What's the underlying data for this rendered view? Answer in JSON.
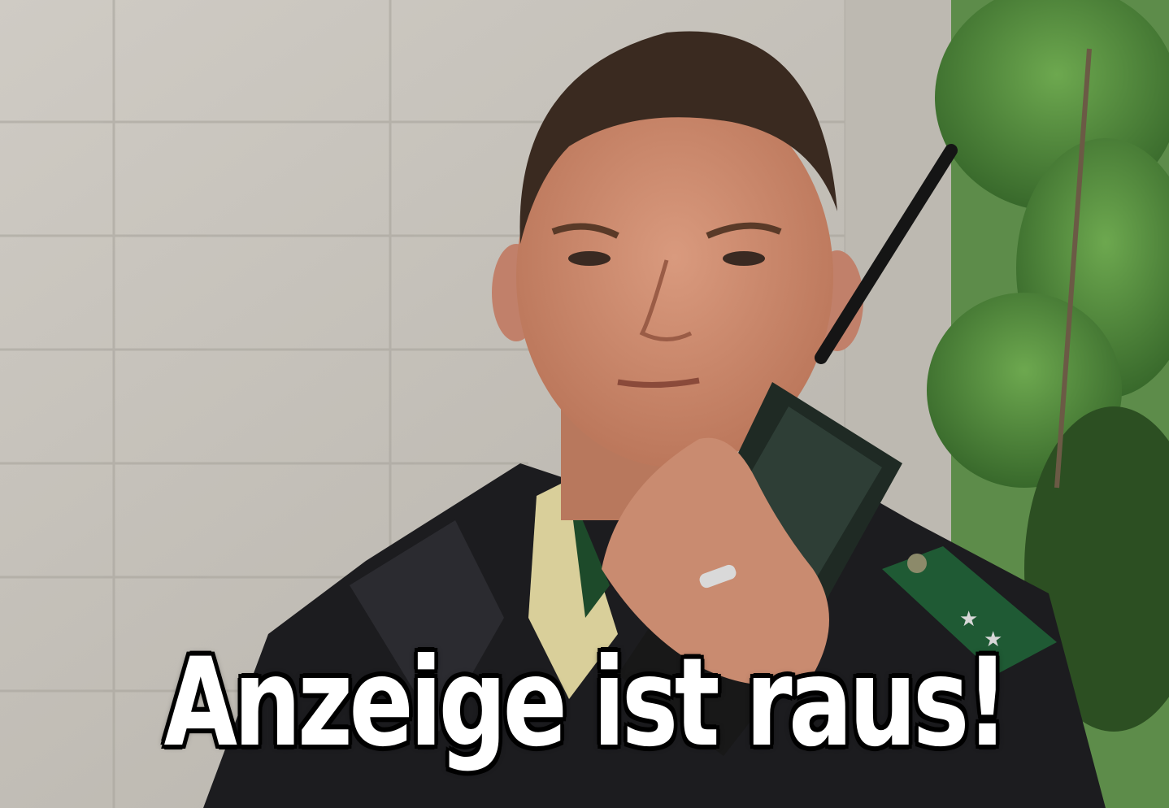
{
  "meme": {
    "caption": "Anzeige ist raus!"
  },
  "photo": {
    "subject": "police-officer-with-radio-icon"
  },
  "colors": {
    "wall": "#c3bfb8",
    "foliage": "#4e8a3a",
    "jacket": "#1b1b1d",
    "skin": "#c98b70",
    "hair": "#3a2a20",
    "radio": "#1f2a24",
    "epaulette": "#1f5a34",
    "caption_fill": "#ffffff",
    "caption_stroke": "#000000"
  }
}
